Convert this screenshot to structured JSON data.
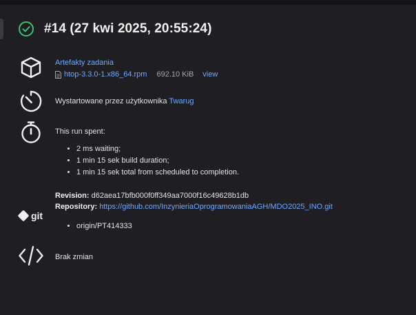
{
  "header": {
    "status_icon": "check-circle-icon",
    "title": "#14 (27 kwi 2025, 20:55:24)"
  },
  "artifacts": {
    "icon": "package-cube-icon",
    "title": "Artefakty zadania",
    "file_icon": "file-icon",
    "file_name": "htop-3.3.0-1.x86_64.rpm",
    "file_size": "692.10 KiB",
    "view_label": "view"
  },
  "started_by": {
    "icon": "timer-icon",
    "prefix": "Wystartowane przez użytkownika",
    "user": "Twarug"
  },
  "run_time": {
    "icon": "stopwatch-icon",
    "title": "This run spent:",
    "items": [
      "2 ms waiting;",
      "1 min 15 sek build duration;",
      "1 min 15 sek total from scheduled to completion."
    ]
  },
  "git": {
    "icon": "git-icon",
    "icon_text": "git",
    "revision_label": "Revision:",
    "revision": "d62aea17bfb000f0ff349aa7000f16c49628b1db",
    "repository_label": "Repository:",
    "repository_url": "https://github.com/InzynieriaOprogramowaniaAGH/MDO2025_INO.git",
    "branches": [
      "origin/PT414333"
    ]
  },
  "changes": {
    "icon": "code-icon",
    "text": "Brak zmian"
  },
  "colors": {
    "background": "#1f1f23",
    "link": "#6fa8ff",
    "success": "#3fbf6f"
  }
}
